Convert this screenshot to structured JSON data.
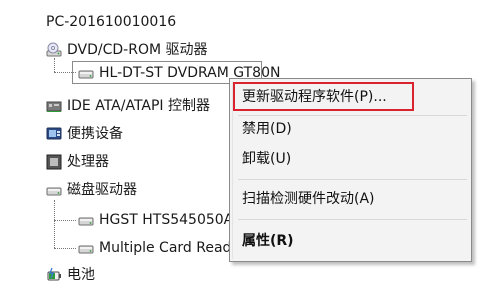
{
  "tree": {
    "computer_name": "PC-201610010016",
    "nodes": [
      {
        "label": "DVD/CD-ROM 驱动器",
        "icon": "optical-drive-icon"
      },
      {
        "label": "HL-DT-ST DVDRAM GT80N",
        "icon": "disk-drive-icon"
      },
      {
        "label": "IDE ATA/ATAPI 控制器",
        "icon": "ide-controller-icon"
      },
      {
        "label": "便携设备",
        "icon": "portable-device-icon"
      },
      {
        "label": "处理器",
        "icon": "processor-icon"
      },
      {
        "label": "磁盘驱动器",
        "icon": "disk-drive-icon"
      },
      {
        "label": "HGST HTS545050A7E680",
        "icon": "disk-drive-icon"
      },
      {
        "label": "Multiple Card Reader",
        "icon": "disk-drive-icon"
      },
      {
        "label": "电池",
        "icon": "battery-icon"
      }
    ]
  },
  "context_menu": {
    "items": [
      {
        "label": "更新驱动程序软件(P)...",
        "highlighted": true
      },
      {
        "label": "禁用(D)"
      },
      {
        "label": "卸载(U)"
      },
      {
        "label": "扫描检测硬件改动(A)"
      },
      {
        "label": "属性(R)",
        "bold": true
      }
    ],
    "highlight_color": "#d9232e"
  }
}
